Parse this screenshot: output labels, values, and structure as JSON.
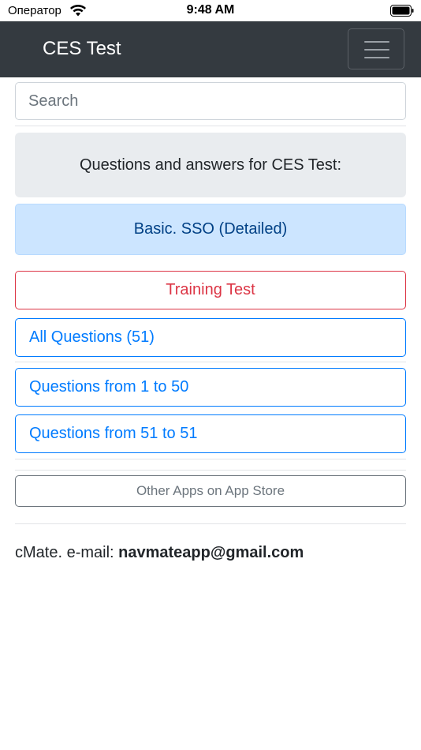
{
  "status_bar": {
    "carrier": "Оператор",
    "time": "9:48 AM"
  },
  "navbar": {
    "brand": "CES Test"
  },
  "search": {
    "placeholder": "Search"
  },
  "header": {
    "text": "Questions and answers for CES Test:"
  },
  "category": {
    "label": "Basic. SSO (Detailed)"
  },
  "buttons": {
    "training": "Training Test",
    "all_questions": "All Questions (51)",
    "range_1": "Questions from 1 to 50",
    "range_2": "Questions from 51 to 51",
    "other_apps": "Other Apps on App Store"
  },
  "footer": {
    "prefix": "cMate. e-mail: ",
    "email": "navmateapp@gmail.com"
  },
  "colors": {
    "navbar": "#343a40",
    "primary": "#007bff",
    "danger": "#dc3545",
    "secondary": "#6c757d",
    "info_bg": "#cce5ff"
  }
}
